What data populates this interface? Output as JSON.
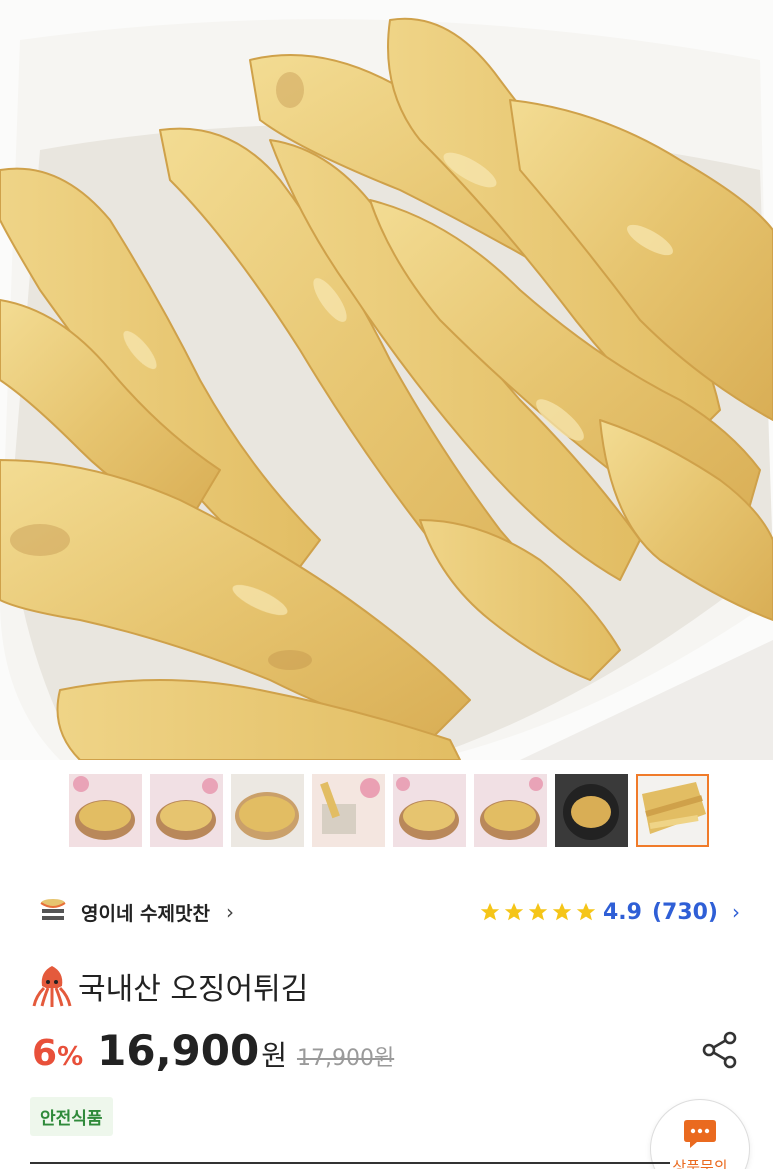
{
  "hero": {
    "image": "fried-squid-product-photo"
  },
  "thumbnails": {
    "count": 8,
    "active_index": 7,
    "icons": [
      "squid-fry-thumb-1",
      "squid-fry-thumb-2",
      "squid-fry-thumb-3",
      "squid-fry-thumb-4",
      "squid-fry-thumb-5",
      "squid-fry-thumb-6",
      "squid-fry-thumb-7",
      "squid-fry-thumb-8"
    ]
  },
  "seller": {
    "name": "영이네 수제맛찬",
    "chevron": "›",
    "logo_icon": "seller-logo-icon"
  },
  "rating": {
    "stars": 5,
    "score": "4.9",
    "count": "(730)",
    "chevron": "›",
    "star_color": "#f5c518",
    "text_color": "#2f5fd6"
  },
  "product": {
    "emoji_icon": "squid-icon",
    "title": "국내산 오징어튀김"
  },
  "price": {
    "discount": "6",
    "discount_unit": "%",
    "sale_price": "16,900",
    "currency": "원",
    "original_price": "17,900원",
    "discount_color": "#e8503a"
  },
  "badge": {
    "label": "안전식품"
  },
  "share": {
    "icon": "share-icon"
  },
  "inquiry": {
    "label": "상품문의",
    "icon": "chat-bubble-icon",
    "accent": "#ea6a1f"
  }
}
